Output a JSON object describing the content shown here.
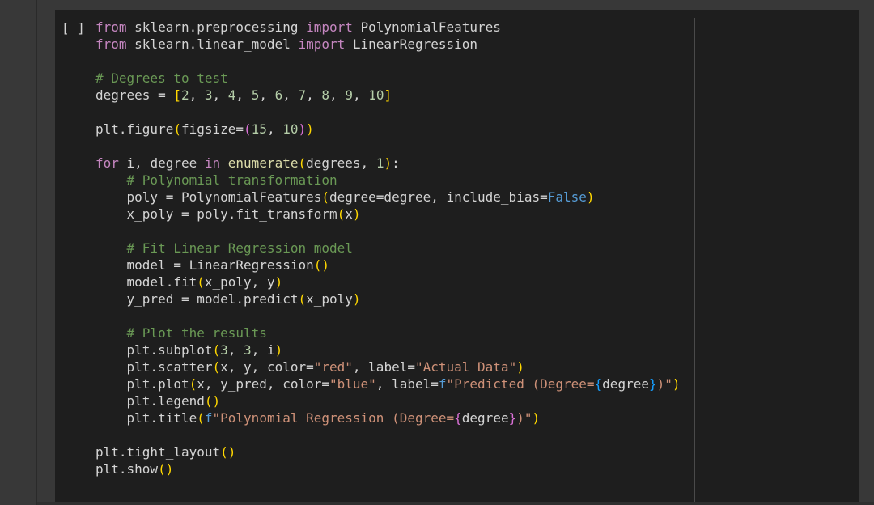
{
  "cell": {
    "run_indicator": "[ ]",
    "lines": [
      [
        {
          "t": "from",
          "c": "kw"
        },
        {
          "t": " sklearn.preprocessing "
        },
        {
          "t": "import",
          "c": "kw"
        },
        {
          "t": " PolynomialFeatures"
        }
      ],
      [
        {
          "t": "from",
          "c": "kw"
        },
        {
          "t": " sklearn.linear_model "
        },
        {
          "t": "import",
          "c": "kw"
        },
        {
          "t": " LinearRegression"
        }
      ],
      [],
      [
        {
          "t": "# Degrees to test",
          "c": "cm"
        }
      ],
      [
        {
          "t": "degrees = "
        },
        {
          "t": "[",
          "c": "p1"
        },
        {
          "t": "2",
          "c": "num"
        },
        {
          "t": ", "
        },
        {
          "t": "3",
          "c": "num"
        },
        {
          "t": ", "
        },
        {
          "t": "4",
          "c": "num"
        },
        {
          "t": ", "
        },
        {
          "t": "5",
          "c": "num"
        },
        {
          "t": ", "
        },
        {
          "t": "6",
          "c": "num"
        },
        {
          "t": ", "
        },
        {
          "t": "7",
          "c": "num"
        },
        {
          "t": ", "
        },
        {
          "t": "8",
          "c": "num"
        },
        {
          "t": ", "
        },
        {
          "t": "9",
          "c": "num"
        },
        {
          "t": ", "
        },
        {
          "t": "10",
          "c": "num"
        },
        {
          "t": "]",
          "c": "p1"
        }
      ],
      [],
      [
        {
          "t": "plt.figure"
        },
        {
          "t": "(",
          "c": "p1"
        },
        {
          "t": "figsize="
        },
        {
          "t": "(",
          "c": "p2"
        },
        {
          "t": "15",
          "c": "num"
        },
        {
          "t": ", "
        },
        {
          "t": "10",
          "c": "num"
        },
        {
          "t": ")",
          "c": "p2"
        },
        {
          "t": ")",
          "c": "p1"
        }
      ],
      [],
      [
        {
          "t": "for",
          "c": "kw"
        },
        {
          "t": " i, degree "
        },
        {
          "t": "in",
          "c": "kw"
        },
        {
          "t": " "
        },
        {
          "t": "enumerate",
          "c": "fn"
        },
        {
          "t": "(",
          "c": "p1"
        },
        {
          "t": "degrees, "
        },
        {
          "t": "1",
          "c": "num"
        },
        {
          "t": ")",
          "c": "p1"
        },
        {
          "t": ":"
        }
      ],
      [
        {
          "t": "    "
        },
        {
          "t": "# Polynomial transformation",
          "c": "cm"
        }
      ],
      [
        {
          "t": "    poly = PolynomialFeatures"
        },
        {
          "t": "(",
          "c": "p1"
        },
        {
          "t": "degree=degree, include_bias="
        },
        {
          "t": "False",
          "c": "bi"
        },
        {
          "t": ")",
          "c": "p1"
        }
      ],
      [
        {
          "t": "    x_poly = poly.fit_transform"
        },
        {
          "t": "(",
          "c": "p1"
        },
        {
          "t": "x"
        },
        {
          "t": ")",
          "c": "p1"
        }
      ],
      [],
      [
        {
          "t": "    "
        },
        {
          "t": "# Fit Linear Regression model",
          "c": "cm"
        }
      ],
      [
        {
          "t": "    model = LinearRegression"
        },
        {
          "t": "(",
          "c": "p1"
        },
        {
          "t": ")",
          "c": "p1"
        }
      ],
      [
        {
          "t": "    model.fit"
        },
        {
          "t": "(",
          "c": "p1"
        },
        {
          "t": "x_poly, y"
        },
        {
          "t": ")",
          "c": "p1"
        }
      ],
      [
        {
          "t": "    y_pred = model.predict"
        },
        {
          "t": "(",
          "c": "p1"
        },
        {
          "t": "x_poly"
        },
        {
          "t": ")",
          "c": "p1"
        }
      ],
      [],
      [
        {
          "t": "    "
        },
        {
          "t": "# Plot the results",
          "c": "cm"
        }
      ],
      [
        {
          "t": "    plt.subplot"
        },
        {
          "t": "(",
          "c": "p1"
        },
        {
          "t": "3",
          "c": "num"
        },
        {
          "t": ", "
        },
        {
          "t": "3",
          "c": "num"
        },
        {
          "t": ", i"
        },
        {
          "t": ")",
          "c": "p1"
        }
      ],
      [
        {
          "t": "    plt.scatter"
        },
        {
          "t": "(",
          "c": "p1"
        },
        {
          "t": "x, y, color="
        },
        {
          "t": "\"red\"",
          "c": "str"
        },
        {
          "t": ", label="
        },
        {
          "t": "\"Actual Data\"",
          "c": "str"
        },
        {
          "t": ")",
          "c": "p1"
        }
      ],
      [
        {
          "t": "    plt.plot"
        },
        {
          "t": "(",
          "c": "p1"
        },
        {
          "t": "x, y_pred, color="
        },
        {
          "t": "\"blue\"",
          "c": "str"
        },
        {
          "t": ", label="
        },
        {
          "t": "f",
          "c": "bi"
        },
        {
          "t": "\"Predicted (Degree=",
          "c": "str"
        },
        {
          "t": "{",
          "c": "p3"
        },
        {
          "t": "degree"
        },
        {
          "t": "}",
          "c": "p3"
        },
        {
          "t": ")\"",
          "c": "str"
        },
        {
          "t": ")",
          "c": "p1"
        }
      ],
      [
        {
          "t": "    plt.legend"
        },
        {
          "t": "(",
          "c": "p1"
        },
        {
          "t": ")",
          "c": "p1"
        }
      ],
      [
        {
          "t": "    plt.title"
        },
        {
          "t": "(",
          "c": "p1"
        },
        {
          "t": "f",
          "c": "bi"
        },
        {
          "t": "\"Polynomial Regression (Degree=",
          "c": "str"
        },
        {
          "t": "{",
          "c": "p2"
        },
        {
          "t": "degree"
        },
        {
          "t": "}",
          "c": "p2"
        },
        {
          "t": ")\"",
          "c": "str"
        },
        {
          "t": ")",
          "c": "p1"
        }
      ],
      [],
      [
        {
          "t": "plt.tight_layout"
        },
        {
          "t": "(",
          "c": "p1"
        },
        {
          "t": ")",
          "c": "p1"
        }
      ],
      [
        {
          "t": "plt.show"
        },
        {
          "t": "(",
          "c": "p1"
        },
        {
          "t": ")",
          "c": "p1"
        }
      ]
    ]
  },
  "colors": {
    "background": "#383838",
    "cell_background": "#1e1e1e",
    "keyword": "#c586c0",
    "comment": "#6a9955",
    "number": "#b5cea8",
    "string": "#ce9178",
    "builtin": "#569cd6",
    "bracket_1": "#ffd700",
    "bracket_2": "#da70d6",
    "bracket_3": "#179fff"
  },
  "icons": [
    "run-indicator"
  ]
}
